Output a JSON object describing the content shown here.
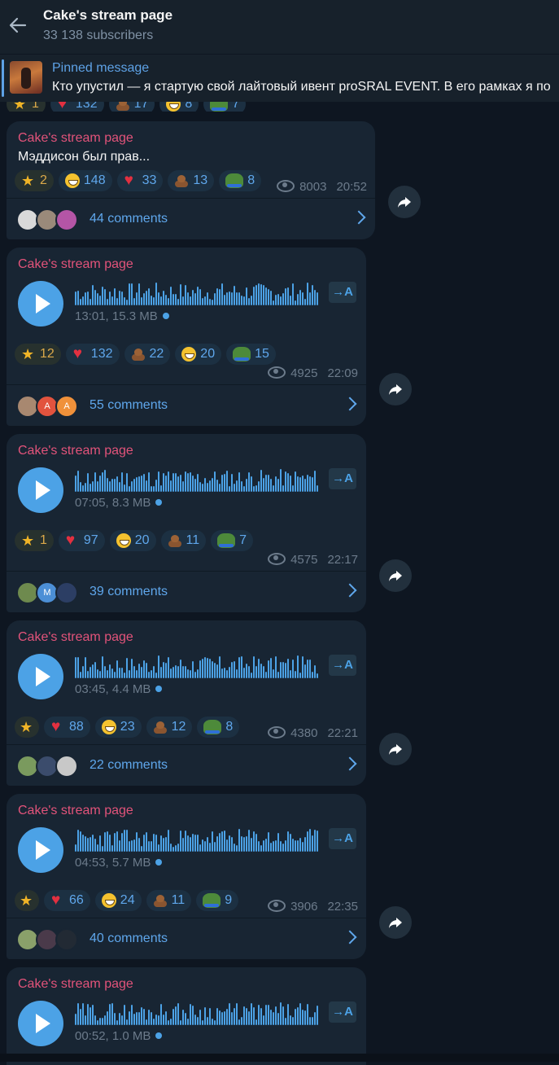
{
  "header": {
    "title": "Cake's stream page",
    "subscribers": "33 138 subscribers"
  },
  "pinned": {
    "label": "Pinned message",
    "text": "Кто упустил — я стартую свой лайтовый ивент proSRAL EVENT.  В его рамках я по"
  },
  "peek_reactions": [
    {
      "emoji": "star-icon",
      "count": "1"
    },
    {
      "emoji": "heart-icon",
      "count": "132"
    },
    {
      "emoji": "poop-icon",
      "count": "17"
    },
    {
      "emoji": "grin-icon",
      "count": "8"
    },
    {
      "emoji": "frog-icon",
      "count": "7"
    }
  ],
  "messages": [
    {
      "author": "Cake's stream page",
      "text": "Мэддисон был прав...",
      "reactions": [
        {
          "emoji": "star-icon",
          "count": "2"
        },
        {
          "emoji": "grin-icon",
          "count": "148"
        },
        {
          "emoji": "heart-icon",
          "count": "33"
        },
        {
          "emoji": "poop-icon",
          "count": "13"
        },
        {
          "emoji": "frog-icon",
          "count": "8"
        }
      ],
      "views": "8003",
      "time": "20:52",
      "comments": "44 comments"
    },
    {
      "author": "Cake's stream page",
      "audio": "13:01, 15.3 MB",
      "transcribe": "A",
      "reactions": [
        {
          "emoji": "star-icon",
          "count": "12"
        },
        {
          "emoji": "heart-icon",
          "count": "132"
        },
        {
          "emoji": "poop-icon",
          "count": "22"
        },
        {
          "emoji": "grin-icon",
          "count": "20"
        },
        {
          "emoji": "frog-icon",
          "count": "15"
        }
      ],
      "views": "4925",
      "time": "22:09",
      "comments": "55 comments",
      "avatar_letters": [
        "A",
        "A"
      ]
    },
    {
      "author": "Cake's stream page",
      "audio": "07:05, 8.3 MB",
      "transcribe": "A",
      "reactions": [
        {
          "emoji": "star-icon",
          "count": "1"
        },
        {
          "emoji": "heart-icon",
          "count": "97"
        },
        {
          "emoji": "grin-icon",
          "count": "20"
        },
        {
          "emoji": "poop-icon",
          "count": "11"
        },
        {
          "emoji": "frog-icon",
          "count": "7"
        }
      ],
      "views": "4575",
      "time": "22:17",
      "comments": "39 comments",
      "avatar_letters": [
        "M"
      ]
    },
    {
      "author": "Cake's stream page",
      "audio": "03:45, 4.4 MB",
      "transcribe": "A",
      "reactions": [
        {
          "emoji": "star-icon",
          "count": ""
        },
        {
          "emoji": "heart-icon",
          "count": "88"
        },
        {
          "emoji": "grin-icon",
          "count": "23"
        },
        {
          "emoji": "poop-icon",
          "count": "12"
        },
        {
          "emoji": "frog-icon",
          "count": "8"
        }
      ],
      "views": "4380",
      "time": "22:21",
      "comments": "22 comments"
    },
    {
      "author": "Cake's stream page",
      "audio": "04:53, 5.7 MB",
      "transcribe": "A",
      "reactions": [
        {
          "emoji": "star-icon",
          "count": ""
        },
        {
          "emoji": "heart-icon",
          "count": "66"
        },
        {
          "emoji": "grin-icon",
          "count": "24"
        },
        {
          "emoji": "poop-icon",
          "count": "11"
        },
        {
          "emoji": "frog-icon",
          "count": "9"
        }
      ],
      "views": "3906",
      "time": "22:35",
      "comments": "40 comments"
    },
    {
      "author": "Cake's stream page",
      "audio": "00:52, 1.0 MB",
      "transcribe": "A"
    }
  ],
  "colors": {
    "background": "#0e1621",
    "bubble": "#182533",
    "accent": "#4ca2e6",
    "author": "#e2537a"
  }
}
